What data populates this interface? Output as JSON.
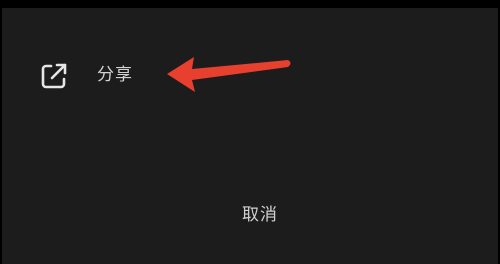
{
  "menu": {
    "share": {
      "icon": "share-external-icon",
      "label": "分享"
    }
  },
  "cancel_label": "取消",
  "annotation": {
    "type": "arrow",
    "color": "#e8402f"
  },
  "colors": {
    "sheet_background": "#1c1c1c",
    "text": "#d2d2d2"
  }
}
